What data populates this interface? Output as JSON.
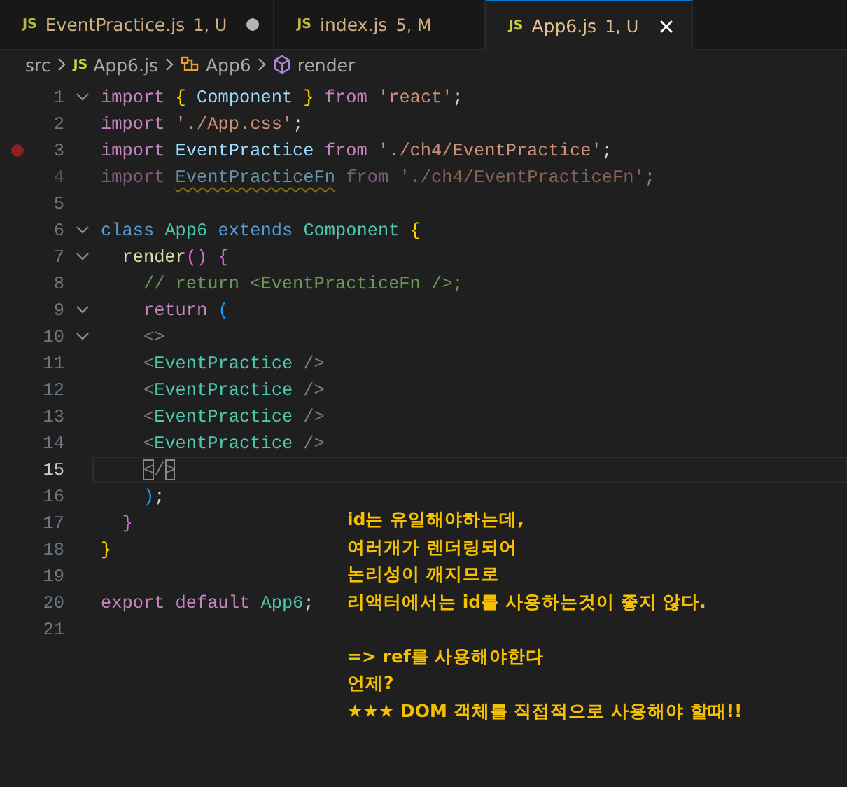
{
  "tabs": [
    {
      "icon": "JS",
      "label": "EventPractice.js",
      "badge": "1, U",
      "selected": false,
      "dirty": true
    },
    {
      "icon": "JS",
      "label": "index.js",
      "badge": "5, M",
      "selected": false,
      "dirty": false
    },
    {
      "icon": "JS",
      "label": "App6.js",
      "badge": "1, U",
      "selected": true,
      "dirty": false
    }
  ],
  "breadcrumb": [
    {
      "kind": "folder",
      "label": "src"
    },
    {
      "kind": "file",
      "icon": "JS",
      "label": "App6.js"
    },
    {
      "kind": "class",
      "label": "App6"
    },
    {
      "kind": "method",
      "label": "render"
    }
  ],
  "lines": [
    {
      "number": "1",
      "fold": true,
      "breakpoint": false,
      "current": false,
      "faded": false,
      "tokens": [
        {
          "text": "import ",
          "kind": "keyword"
        },
        {
          "text": "{ ",
          "kind": "brace"
        },
        {
          "text": "Component ",
          "kind": "variable"
        },
        {
          "text": "} ",
          "kind": "brace"
        },
        {
          "text": "from ",
          "kind": "keyword"
        },
        {
          "text": "'react'",
          "kind": "string"
        },
        {
          "text": ";",
          "kind": "plain"
        }
      ]
    },
    {
      "number": "2",
      "fold": false,
      "breakpoint": false,
      "current": false,
      "faded": false,
      "tokens": [
        {
          "text": "import ",
          "kind": "keyword"
        },
        {
          "text": "'./App.css'",
          "kind": "string"
        },
        {
          "text": ";",
          "kind": "plain"
        }
      ]
    },
    {
      "number": "3",
      "fold": false,
      "breakpoint": true,
      "current": false,
      "faded": false,
      "tokens": [
        {
          "text": "import ",
          "kind": "keyword"
        },
        {
          "text": "EventPractice ",
          "kind": "variable"
        },
        {
          "text": "from ",
          "kind": "keyword"
        },
        {
          "text": "'./ch4/EventPractice'",
          "kind": "string"
        },
        {
          "text": ";",
          "kind": "plain"
        }
      ]
    },
    {
      "number": "4",
      "fold": false,
      "breakpoint": false,
      "current": false,
      "faded": true,
      "tokens": [
        {
          "text": "import ",
          "kind": "keyword"
        },
        {
          "text": "EventPracticeFn",
          "kind": "variable",
          "warning": true
        },
        {
          "text": " from ",
          "kind": "keyword"
        },
        {
          "text": "'./ch4/EventPracticeFn'",
          "kind": "string"
        },
        {
          "text": ";",
          "kind": "plain"
        }
      ]
    },
    {
      "number": "5",
      "fold": false,
      "breakpoint": false,
      "current": false,
      "faded": false
    },
    {
      "number": "6",
      "fold": true,
      "breakpoint": false,
      "current": false,
      "faded": false,
      "tokens": [
        {
          "text": "class ",
          "kind": "storage"
        },
        {
          "text": "App6 ",
          "kind": "type"
        },
        {
          "text": "extends ",
          "kind": "storage"
        },
        {
          "text": "Component ",
          "kind": "type"
        },
        {
          "text": "{",
          "kind": "brace"
        }
      ]
    },
    {
      "number": "7",
      "fold": true,
      "breakpoint": false,
      "current": false,
      "faded": false,
      "tokens": [
        {
          "text": "  render",
          "kind": "function"
        },
        {
          "text": "() {",
          "kind": "paren"
        }
      ]
    },
    {
      "number": "8",
      "fold": false,
      "breakpoint": false,
      "current": false,
      "faded": false,
      "tokens": [
        {
          "text": "    // return <EventPracticeFn />;",
          "kind": "comment"
        }
      ]
    },
    {
      "number": "9",
      "fold": true,
      "breakpoint": false,
      "current": false,
      "faded": false,
      "tokens": [
        {
          "text": "    return ",
          "kind": "keyword"
        },
        {
          "text": "(",
          "kind": "paren2"
        }
      ]
    },
    {
      "number": "10",
      "fold": true,
      "breakpoint": false,
      "current": false,
      "faded": false,
      "tokens": [
        {
          "text": "    <>",
          "kind": "tag"
        }
      ]
    },
    {
      "number": "11",
      "fold": false,
      "breakpoint": false,
      "current": false,
      "faded": false,
      "tokens": [
        {
          "text": "    <",
          "kind": "tag"
        },
        {
          "text": "EventPractice",
          "kind": "type"
        },
        {
          "text": " />",
          "kind": "tag"
        }
      ]
    },
    {
      "number": "12",
      "fold": false,
      "breakpoint": false,
      "current": false,
      "faded": false,
      "tokens": [
        {
          "text": "    <",
          "kind": "tag"
        },
        {
          "text": "EventPractice",
          "kind": "type"
        },
        {
          "text": " />",
          "kind": "tag"
        }
      ]
    },
    {
      "number": "13",
      "fold": false,
      "breakpoint": false,
      "current": false,
      "faded": false,
      "tokens": [
        {
          "text": "    <",
          "kind": "tag"
        },
        {
          "text": "EventPractice",
          "kind": "type"
        },
        {
          "text": " />",
          "kind": "tag"
        }
      ]
    },
    {
      "number": "14",
      "fold": false,
      "breakpoint": false,
      "current": false,
      "faded": false,
      "tokens": [
        {
          "text": "    <",
          "kind": "tag"
        },
        {
          "text": "EventPractice",
          "kind": "type"
        },
        {
          "text": " />",
          "kind": "tag"
        }
      ]
    },
    {
      "number": "15",
      "fold": false,
      "breakpoint": false,
      "current": true,
      "faded": false,
      "tokens": [
        {
          "text": "    <",
          "kind": "match"
        },
        {
          "text": "/",
          "kind": "tag"
        },
        {
          "text": ">",
          "kind": "match"
        }
      ]
    },
    {
      "number": "16",
      "fold": false,
      "breakpoint": false,
      "current": false,
      "faded": false,
      "tokens": [
        {
          "text": "    )",
          "kind": "paren2"
        },
        {
          "text": ";",
          "kind": "plain"
        }
      ]
    },
    {
      "number": "17",
      "fold": false,
      "breakpoint": false,
      "current": false,
      "faded": false,
      "tokens": [
        {
          "text": "  }",
          "kind": "paren"
        }
      ]
    },
    {
      "number": "18",
      "fold": false,
      "breakpoint": false,
      "current": false,
      "faded": false,
      "tokens": [
        {
          "text": "}",
          "kind": "brace"
        }
      ]
    },
    {
      "number": "19",
      "fold": false,
      "breakpoint": false,
      "current": false,
      "faded": false
    },
    {
      "number": "20",
      "fold": false,
      "breakpoint": false,
      "current": false,
      "faded": false,
      "tokens": [
        {
          "text": "export default ",
          "kind": "keyword"
        },
        {
          "text": "App6",
          "kind": "type"
        },
        {
          "text": ";",
          "kind": "plain"
        }
      ]
    },
    {
      "number": "21",
      "fold": false,
      "breakpoint": false,
      "current": false,
      "faded": false
    }
  ],
  "note": [
    [
      "id는 유일해야하는데,",
      "여러개가 렌더링되어",
      "논리성이 깨지므로",
      "리액터에서는 id를 사용하는것이 좋지 않다."
    ],
    [
      "=> ref를 사용해야한다",
      "언제?",
      "★★★ DOM 객체를 직접적으로 사용해야 할때!!"
    ]
  ]
}
